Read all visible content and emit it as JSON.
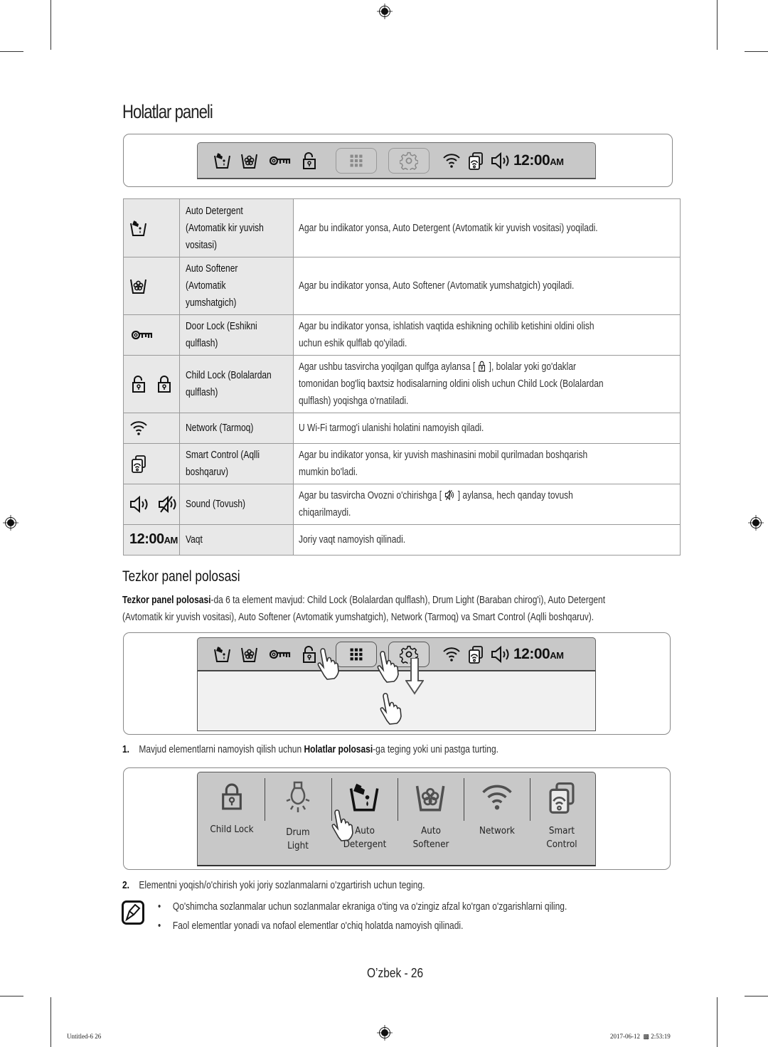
{
  "page": {
    "title": "Holatlar paneli",
    "section_title": "Tezkor panel polosasi",
    "page_number": "O’zbek - 26"
  },
  "status_bar": {
    "icons": [
      "auto-detergent-icon",
      "auto-softener-icon",
      "door-lock-icon",
      "child-lock-unlocked-icon",
      "quick-panel-grid-icon",
      "settings-gear-icon",
      "wifi-network-icon",
      "smart-control-icon",
      "sound-icon"
    ],
    "clock_time": "12:00",
    "clock_suffix": "AM"
  },
  "table": {
    "rows": [
      {
        "icons": [
          "auto-detergent-icon"
        ],
        "name": "Auto Detergent (Avtomatik kir yuvish vositasi)",
        "name_lines": [
          "Auto Detergent",
          "(Avtomatik kir yuvish",
          "vositasi)"
        ],
        "description": "Agar bu indikator yonsa, Auto Detergent (Avtomatik kir yuvish vositasi) yoqiladi."
      },
      {
        "icons": [
          "auto-softener-icon"
        ],
        "name": "Auto Softener (Avtomatik yumshatgich)",
        "name_lines": [
          "Auto Softener",
          "(Avtomatik",
          "yumshatgich)"
        ],
        "description": "Agar bu indikator yonsa, Auto Softener (Avtomatik yumshatgich) yoqiladi."
      },
      {
        "icons": [
          "door-lock-icon"
        ],
        "name": "Door Lock (Eshikni qulflash)",
        "name_lines": [
          "Door Lock (Eshikni",
          "qulflash)"
        ],
        "description_lines": [
          "Agar bu indikator yonsa, ishlatish vaqtida eshikning ochilib ketishini oldini olish",
          "uchun eshik qulflab qo'yiladi."
        ]
      },
      {
        "icons": [
          "child-lock-unlocked-icon",
          "child-lock-locked-icon"
        ],
        "name": "Child Lock (Bolalardan qulflash)",
        "name_lines": [
          "Child Lock (Bolalardan",
          "qulflash)"
        ],
        "description_lines": [
          "Agar ushbu tasvircha yoqilgan qulfga aylansa [",
          "], bolalar yoki go'daklar",
          "tomonidan bog'liq baxtsiz hodisalarning oldini olish uchun Child Lock (Bolalardan",
          "qulflash) yoqishga o'rnatiladi."
        ]
      },
      {
        "icons": [
          "wifi-network-icon"
        ],
        "name": "Network (Tarmoq)",
        "description": "U Wi-Fi tarmog'i ulanishi holatini namoyish qiladi."
      },
      {
        "icons": [
          "smart-control-icon"
        ],
        "name": "Smart Control (Aqlli boshqaruv)",
        "name_lines": [
          "Smart Control (Aqlli",
          "boshqaruv)"
        ],
        "description_lines": [
          "Agar bu indikator yonsa, kir yuvish mashinasini mobil qurilmadan boshqarish",
          "mumkin bo'ladi."
        ]
      },
      {
        "icons": [
          "sound-on-icon",
          "sound-muted-icon"
        ],
        "name": "Sound (Tovush)",
        "description_lines": [
          "Agar bu tasvircha Ovozni o'chirishga [",
          "] aylansa, hech qanday tovush",
          "chiqarilmaydi."
        ]
      },
      {
        "icons": [
          "clock-display"
        ],
        "clock_time": "12:00",
        "clock_suffix": "AM",
        "name": "Vaqt",
        "description": "Joriy vaqt namoyish qilinadi."
      }
    ]
  },
  "intro": {
    "bold": "Tezkor panel polosasi",
    "text_line1": "-da 6 ta element mavjud: Child Lock (Bolalardan qulflash), Drum Light (Baraban chirog'i), Auto Detergent",
    "text_line2": "(Avtomatik kir yuvish vositasi), Auto Softener (Avtomatik yumshatgich), Network (Tarmoq) va Smart Control (Aqlli boshqaruv)."
  },
  "steps": [
    {
      "number": "1.",
      "before": "Mavjud elementlarni namoyish qilish uchun ",
      "bold": "Holatlar polosasi",
      "after": "-ga teging yoki uni pastga turting."
    },
    {
      "number": "2.",
      "text": "Elementni yoqish/o'chirish yoki joriy sozlanmalarni o'zgartirish uchun teging."
    }
  ],
  "quick_panel": {
    "items": [
      {
        "icon": "child-lock-icon",
        "label_lines": [
          "Child Lock"
        ]
      },
      {
        "icon": "drum-light-icon",
        "label_lines": [
          "Drum",
          "Light"
        ]
      },
      {
        "icon": "auto-detergent-icon",
        "label_lines": [
          "Auto",
          "Detergent"
        ]
      },
      {
        "icon": "auto-softener-icon",
        "label_lines": [
          "Auto",
          "Softener"
        ]
      },
      {
        "icon": "network-icon",
        "label_lines": [
          "Network"
        ]
      },
      {
        "icon": "smart-control-icon",
        "label_lines": [
          "Smart",
          "Control"
        ]
      }
    ]
  },
  "notes": [
    "Qo'shimcha sozlanmalar uchun sozlanmalar ekraniga o'ting va o'zingiz afzal ko'rgan o'zgarishlarni qiling.",
    "Faol elementlar yonadi va nofaol elementlar o'chiq holatda namoyish qilinadi."
  ],
  "print_footer": {
    "file": "Untitled-6   26",
    "date": "2017-06-12",
    "time": "2:53:19"
  }
}
